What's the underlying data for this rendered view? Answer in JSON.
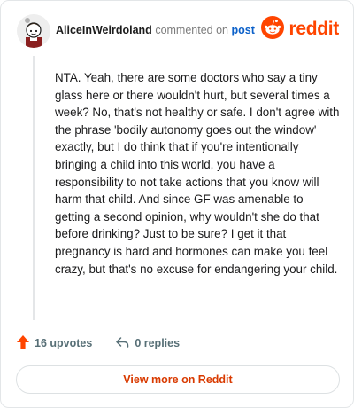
{
  "header": {
    "username": "AliceInWeirdoland",
    "action_text": "commented on",
    "post_link": "post",
    "brand_name": "reddit"
  },
  "comment": {
    "text": "NTA. Yeah, there are some doctors who say a tiny glass here or there wouldn't hurt, but several times a week? No, that's not healthy or safe. I don't agree with the phrase 'bodily autonomy goes out the window' exactly, but I do think that if you're intentionally bringing a child into this world, you have a responsibility to not take actions that you know will harm that child. And since GF was amenable to getting a second opinion, why wouldn't she do that before drinking? Just to be sure? I get it that pregnancy is hard and hormones can make you feel crazy, but that's no excuse for endangering your child."
  },
  "actions": {
    "upvotes_label": "16 upvotes",
    "replies_label": "0 replies"
  },
  "footer": {
    "view_more_label": "View more on Reddit"
  },
  "icons": {
    "upvote": "upvote-arrow-icon",
    "reply": "reply-arrow-icon",
    "brand": "reddit-snoo-icon",
    "avatar": "user-avatar"
  },
  "colors": {
    "brand": "#ff4500",
    "link": "#0b60c9",
    "view_more": "#d93a00",
    "muted": "#576f76"
  }
}
